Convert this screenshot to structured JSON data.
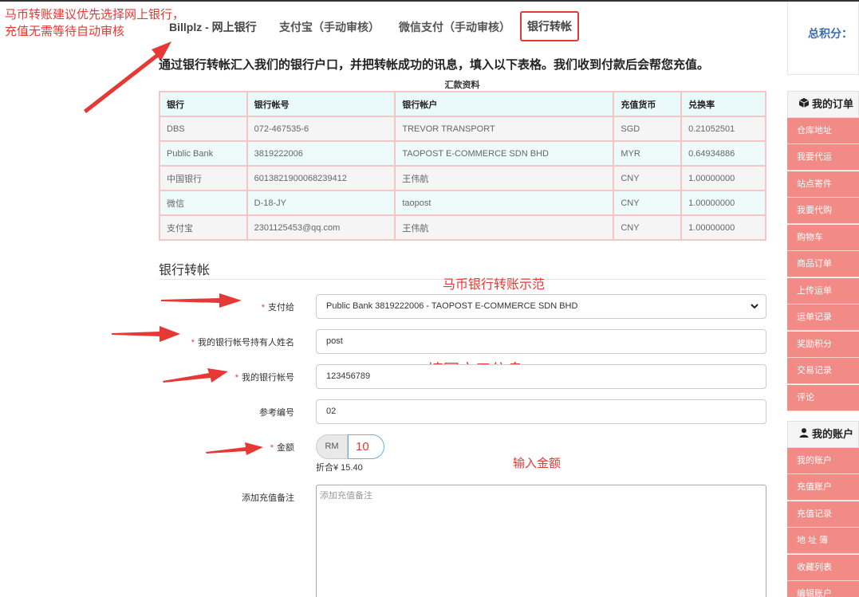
{
  "annotations": {
    "top_note": "马币转账建议优先选择网上银行，\n充值无需等待自动审核",
    "bank_transfer_example": "马币银行转账示范",
    "fill_account_info": "填写户口信息",
    "enter_amount": "输入金额"
  },
  "tabs": [
    {
      "label": "Billplz - 网上银行"
    },
    {
      "label": "支付宝（手动审核）"
    },
    {
      "label": "微信支付（手动审核）"
    },
    {
      "label": "银行转帐",
      "active": true
    }
  ],
  "intro": "通过银行转帐汇入我们的银行户口，并把转帐成功的讯息，填入以下表格。我们收到付款后会帮您充值。",
  "table": {
    "caption": "汇款资料",
    "headers": [
      "银行",
      "银行帐号",
      "银行帐户",
      "充值货币",
      "兑换率"
    ],
    "rows": [
      [
        "DBS",
        "072-467535-6",
        "TREVOR TRANSPORT",
        "SGD",
        "0.21052501"
      ],
      [
        "Public Bank",
        "3819222006",
        "TAOPOST E-COMMERCE SDN BHD",
        "MYR",
        "0.64934886"
      ],
      [
        "中国银行",
        "6013821900068239412",
        "王伟航",
        "CNY",
        "1.00000000"
      ],
      [
        "微信",
        "D-18-JY",
        "taopost",
        "CNY",
        "1.00000000"
      ],
      [
        "支付宝",
        "2301125453@qq.com",
        "王伟航",
        "CNY",
        "1.00000000"
      ]
    ]
  },
  "form": {
    "section_title": "银行转帐",
    "pay_to_label": "支付给",
    "pay_to_value": "Public Bank 3819222006 - TAOPOST E-COMMERCE SDN BHD",
    "holder_name_label": "我的银行帐号持有人姓名",
    "holder_name_value": "post",
    "account_no_label": "我的银行帐号",
    "account_no_value": "123456789",
    "reference_label": "参考编号",
    "reference_value": "02",
    "amount_label": "金额",
    "currency": "RM",
    "amount_value": "10",
    "rate_note": "折合¥ 15.40",
    "remark_label": "添加充值备注",
    "remark_placeholder": "添加充值备注",
    "required_mark": "*"
  },
  "sidebar": {
    "points_label": "总积分：",
    "orders_title": "我的订单",
    "order_items": [
      "仓库地址",
      "我要代运",
      "站点寄件",
      "我要代购",
      "购物车",
      "商品订单",
      "上传运单",
      "运单记录",
      "奖励积分",
      "交易记录",
      "评论"
    ],
    "account_title": "我的账户",
    "account_items": [
      "我的账户",
      "充值账户",
      "充值记录",
      "地 址 簿",
      "收藏列表",
      "编辑账户"
    ]
  },
  "colors": {
    "accent_red": "#e53935",
    "sidebar_menu": "#f28a85",
    "points_blue": "#3a6db0"
  },
  "icons": {
    "orders": "cube-icon",
    "account": "user-icon",
    "select": "chevron-down-icon"
  }
}
